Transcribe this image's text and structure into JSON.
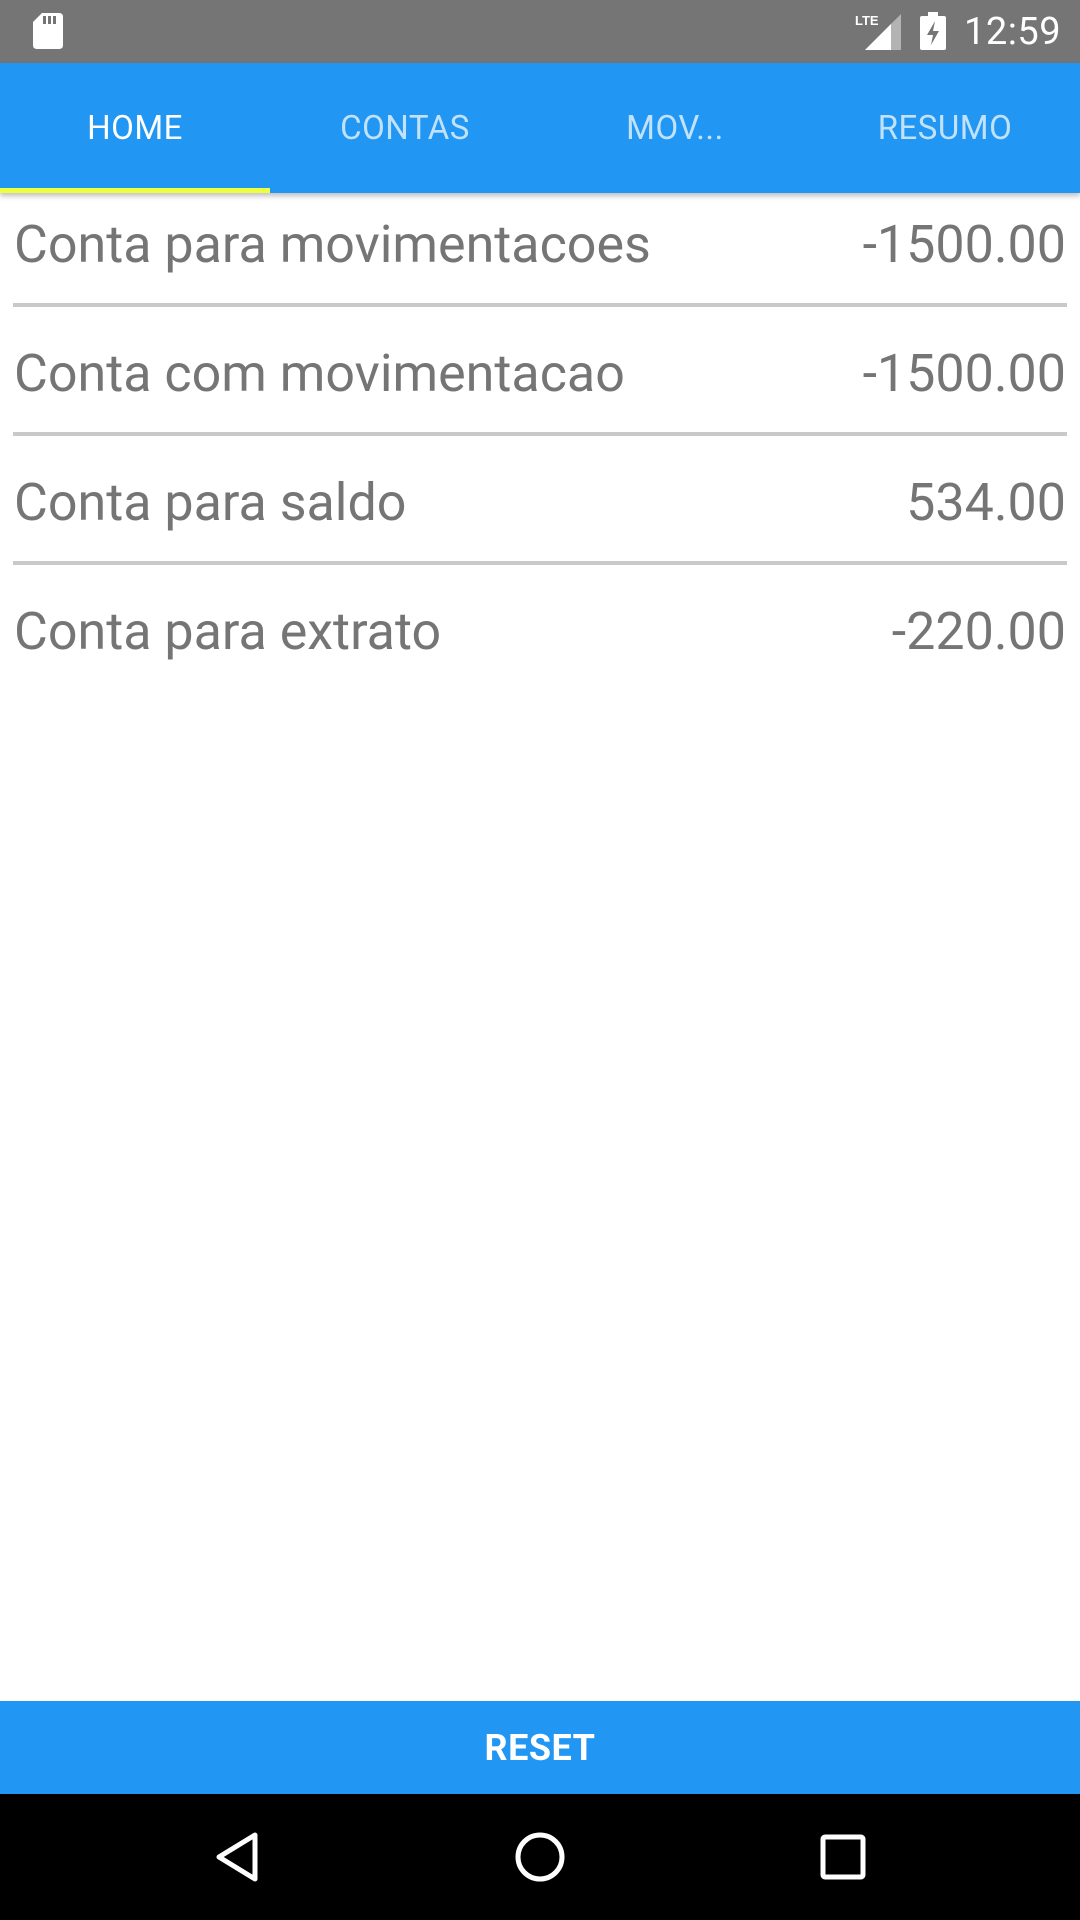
{
  "status_bar": {
    "time": "12:59",
    "network_label": "LTE",
    "icons": [
      "sd-card-icon",
      "lte-signal-icon",
      "battery-charging-icon"
    ]
  },
  "tabs": [
    {
      "label": "HOME",
      "active": true
    },
    {
      "label": "CONTAS",
      "active": false
    },
    {
      "label": "MOV...",
      "active": false
    },
    {
      "label": "RESUMO",
      "active": false
    }
  ],
  "accounts": [
    {
      "name": "Conta para movimentacoes",
      "balance": "-1500.00"
    },
    {
      "name": "Conta com movimentacao",
      "balance": "-1500.00"
    },
    {
      "name": "Conta para saldo",
      "balance": "534.00"
    },
    {
      "name": "Conta para extrato",
      "balance": "-220.00"
    }
  ],
  "reset_button": {
    "label": "RESET"
  },
  "nav_bar": {
    "icons": [
      "back-icon",
      "home-icon",
      "recents-icon"
    ]
  },
  "colors": {
    "primary": "#2196f3",
    "status_bar": "#757575",
    "tab_indicator": "#eeff41",
    "text_gray": "#757575",
    "divider": "#c9c9c9"
  }
}
